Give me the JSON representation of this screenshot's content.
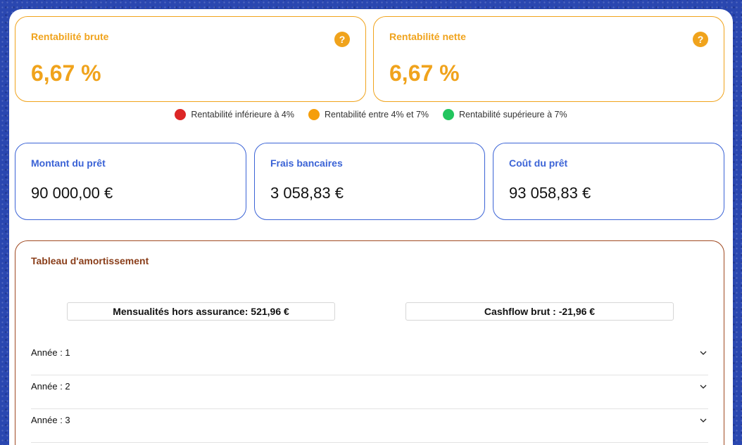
{
  "rentabilite": {
    "brute": {
      "title": "Rentabilité brute",
      "value": "6,67 %",
      "help": "?"
    },
    "nette": {
      "title": "Rentabilité nette",
      "value": "6,67 %",
      "help": "?"
    }
  },
  "legend": [
    {
      "label": "Rentabilité inférieure à 4%",
      "color": "#dc2626"
    },
    {
      "label": "Rentabilité entre 4% et 7%",
      "color": "#f59e0b"
    },
    {
      "label": "Rentabilité supérieure à 7%",
      "color": "#22c55e"
    }
  ],
  "loan": {
    "montant": {
      "title": "Montant du prêt",
      "value": "90 000,00 €"
    },
    "frais": {
      "title": "Frais bancaires",
      "value": "3 058,83 €"
    },
    "cout": {
      "title": "Coût du prêt",
      "value": "93 058,83 €"
    }
  },
  "amortissement": {
    "title": "Tableau d'amortissement",
    "mensualites": "Mensualités hors assurance: 521,96 €",
    "cashflow": "Cashflow brut : -21,96 €",
    "years": [
      "Année : 1",
      "Année : 2",
      "Année : 3"
    ]
  },
  "colors": {
    "orange": "#f0a31c",
    "blue": "#3b63d6",
    "brown": "#a04a22",
    "background": "#2a47b0"
  }
}
